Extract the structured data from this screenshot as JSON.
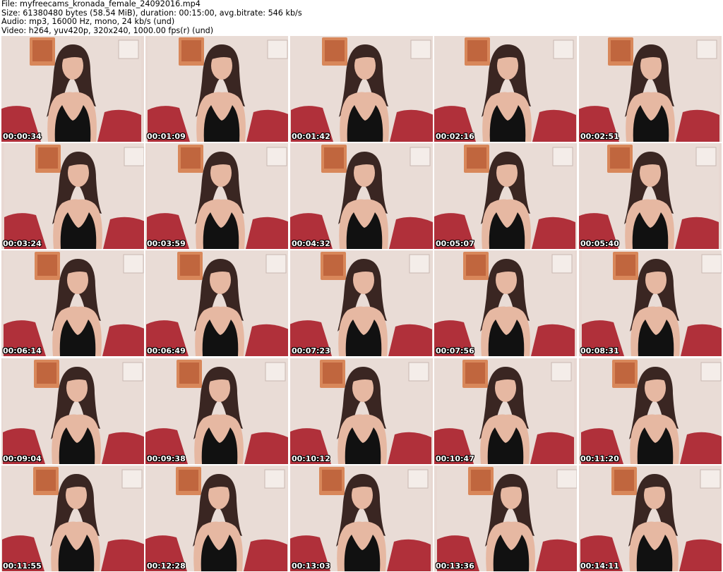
{
  "header": {
    "file_line": "File: myfreecams_kronada_female_24092016.mp4",
    "size_line": "Size: 61380480 bytes (58.54 MiB), duration: 00:15:00, avg.bitrate: 546 kb/s",
    "audio_line": "Audio: mp3, 16000 Hz, mono, 24 kb/s (und)",
    "video_line": "Video: h264, yuv420p, 320x240, 1000.00 fps(r) (und)"
  },
  "thumbnails": [
    {
      "timestamp": "00:00:34"
    },
    {
      "timestamp": "00:01:09"
    },
    {
      "timestamp": "00:01:42"
    },
    {
      "timestamp": "00:02:16"
    },
    {
      "timestamp": "00:02:51"
    },
    {
      "timestamp": "00:03:24"
    },
    {
      "timestamp": "00:03:59"
    },
    {
      "timestamp": "00:04:32"
    },
    {
      "timestamp": "00:05:07"
    },
    {
      "timestamp": "00:05:40"
    },
    {
      "timestamp": "00:06:14"
    },
    {
      "timestamp": "00:06:49"
    },
    {
      "timestamp": "00:07:23"
    },
    {
      "timestamp": "00:07:56"
    },
    {
      "timestamp": "00:08:31"
    },
    {
      "timestamp": "00:09:04"
    },
    {
      "timestamp": "00:09:38"
    },
    {
      "timestamp": "00:10:12"
    },
    {
      "timestamp": "00:10:47"
    },
    {
      "timestamp": "00:11:20"
    },
    {
      "timestamp": "00:11:55"
    },
    {
      "timestamp": "00:12:28"
    },
    {
      "timestamp": "00:13:03"
    },
    {
      "timestamp": "00:13:36"
    },
    {
      "timestamp": "00:14:11"
    }
  ],
  "colors": {
    "wall": "#e9dcd6",
    "sofa": "#b0303a",
    "hair": "#3a2622",
    "skin": "#e6b8a2",
    "dress": "#111111",
    "poster": "#d8875a",
    "timestamp_text": "#ffffff"
  }
}
